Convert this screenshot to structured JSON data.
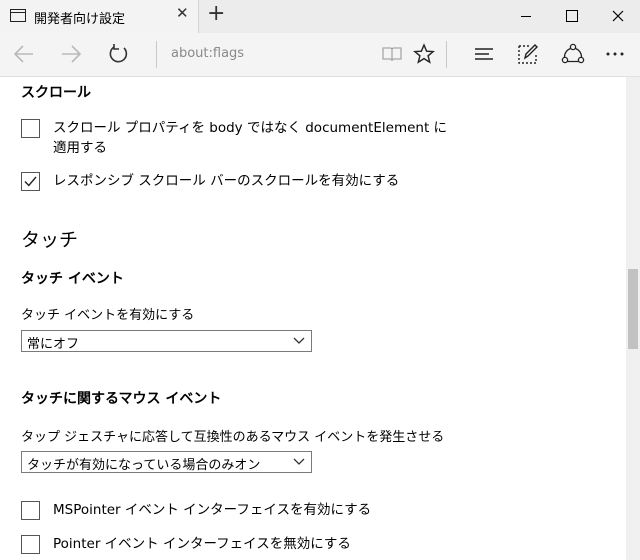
{
  "tab": {
    "title": "開発者向け設定",
    "icon": "tab-page-icon",
    "close_glyph": "✕"
  },
  "newtab": {
    "glyph": "+"
  },
  "window": {
    "min": "minimize-icon",
    "max": "maximize-icon",
    "close": "close-icon"
  },
  "nav": {
    "address": "about:flags",
    "icons": [
      "back-icon",
      "forward-icon",
      "refresh-icon",
      "reading-view-icon",
      "favorite-star-icon",
      "hub-icon",
      "web-note-icon",
      "share-icon",
      "more-icon"
    ]
  },
  "sections": {
    "scroll": {
      "heading": "スクロール",
      "option1": {
        "line1": "スクロール プロパティを body ではなく documentElement に",
        "line2": "適用する",
        "checked": false
      },
      "option2": {
        "label": "レスポンシブ スクロール バーのスクロールを有効にする",
        "checked": true
      }
    },
    "touch": {
      "heading": "タッチ",
      "events": {
        "heading": "タッチ イベント",
        "label": "タッチ イベントを有効にする",
        "selected": "常にオフ"
      },
      "mouse": {
        "heading": "タッチに関するマウス イベント",
        "label": "タップ ジェスチャに応答して互換性のあるマウス イベントを発生させる",
        "selected": "タッチが有効になっている場合のみオン"
      },
      "option_mspointer": {
        "label": "MSPointer イベント インターフェイスを有効にする",
        "checked": false
      },
      "option_pointer": {
        "label": "Pointer イベント インターフェイスを無効にする",
        "checked": false
      }
    }
  },
  "colors": {
    "tabbar": "#ececec",
    "navbar": "#f4f4f4",
    "scroll_thumb": "#c2c2c2"
  }
}
